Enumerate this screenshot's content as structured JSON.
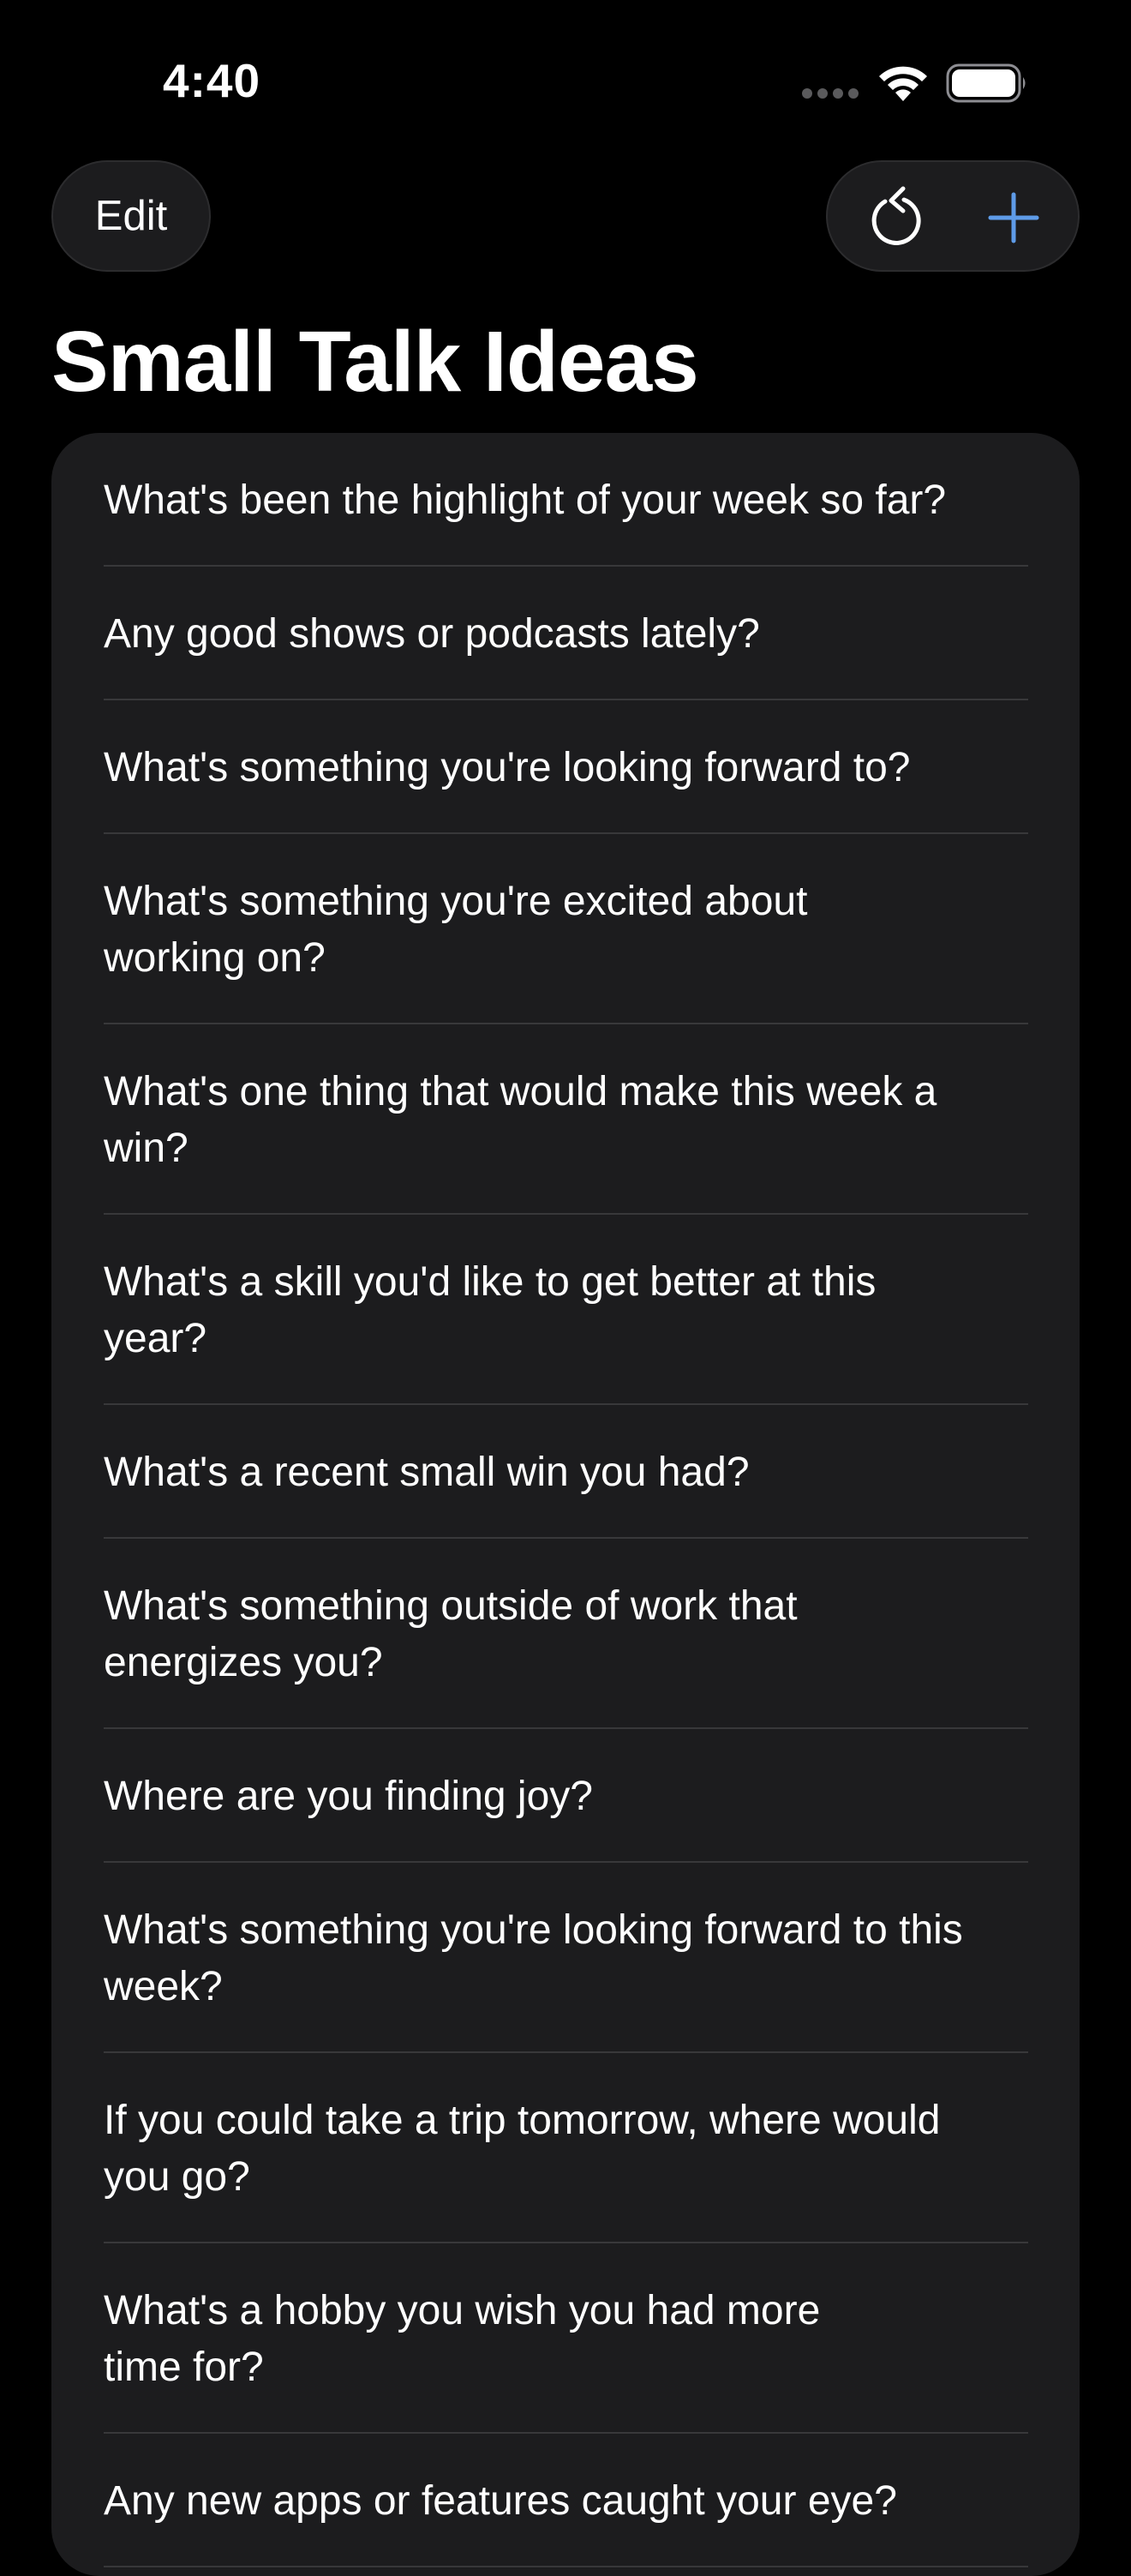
{
  "status_bar": {
    "time": "4:40"
  },
  "nav": {
    "edit_label": "Edit",
    "reset_icon": "arrow-counterclockwise-icon",
    "add_icon": "plus-icon",
    "accent_color": "#5e9be8"
  },
  "title": "Small Talk Ideas",
  "items": [
    "What's been the highlight of your week so far?",
    "Any good shows or podcasts lately?",
    "What's something you're looking forward to?",
    "What's something you're excited about working on?",
    "What's one thing that would make this week a win?",
    "What's a skill you'd like to get better at this year?",
    "What's a recent small win you had?",
    "What's something outside of work that energizes you?",
    "Where are you finding joy?",
    "What's something you're looking forward to this week?",
    "If you could take a trip tomorrow, where would you go?",
    "What's a hobby you wish you had more time for?",
    "Any new apps or features caught your eye?"
  ]
}
